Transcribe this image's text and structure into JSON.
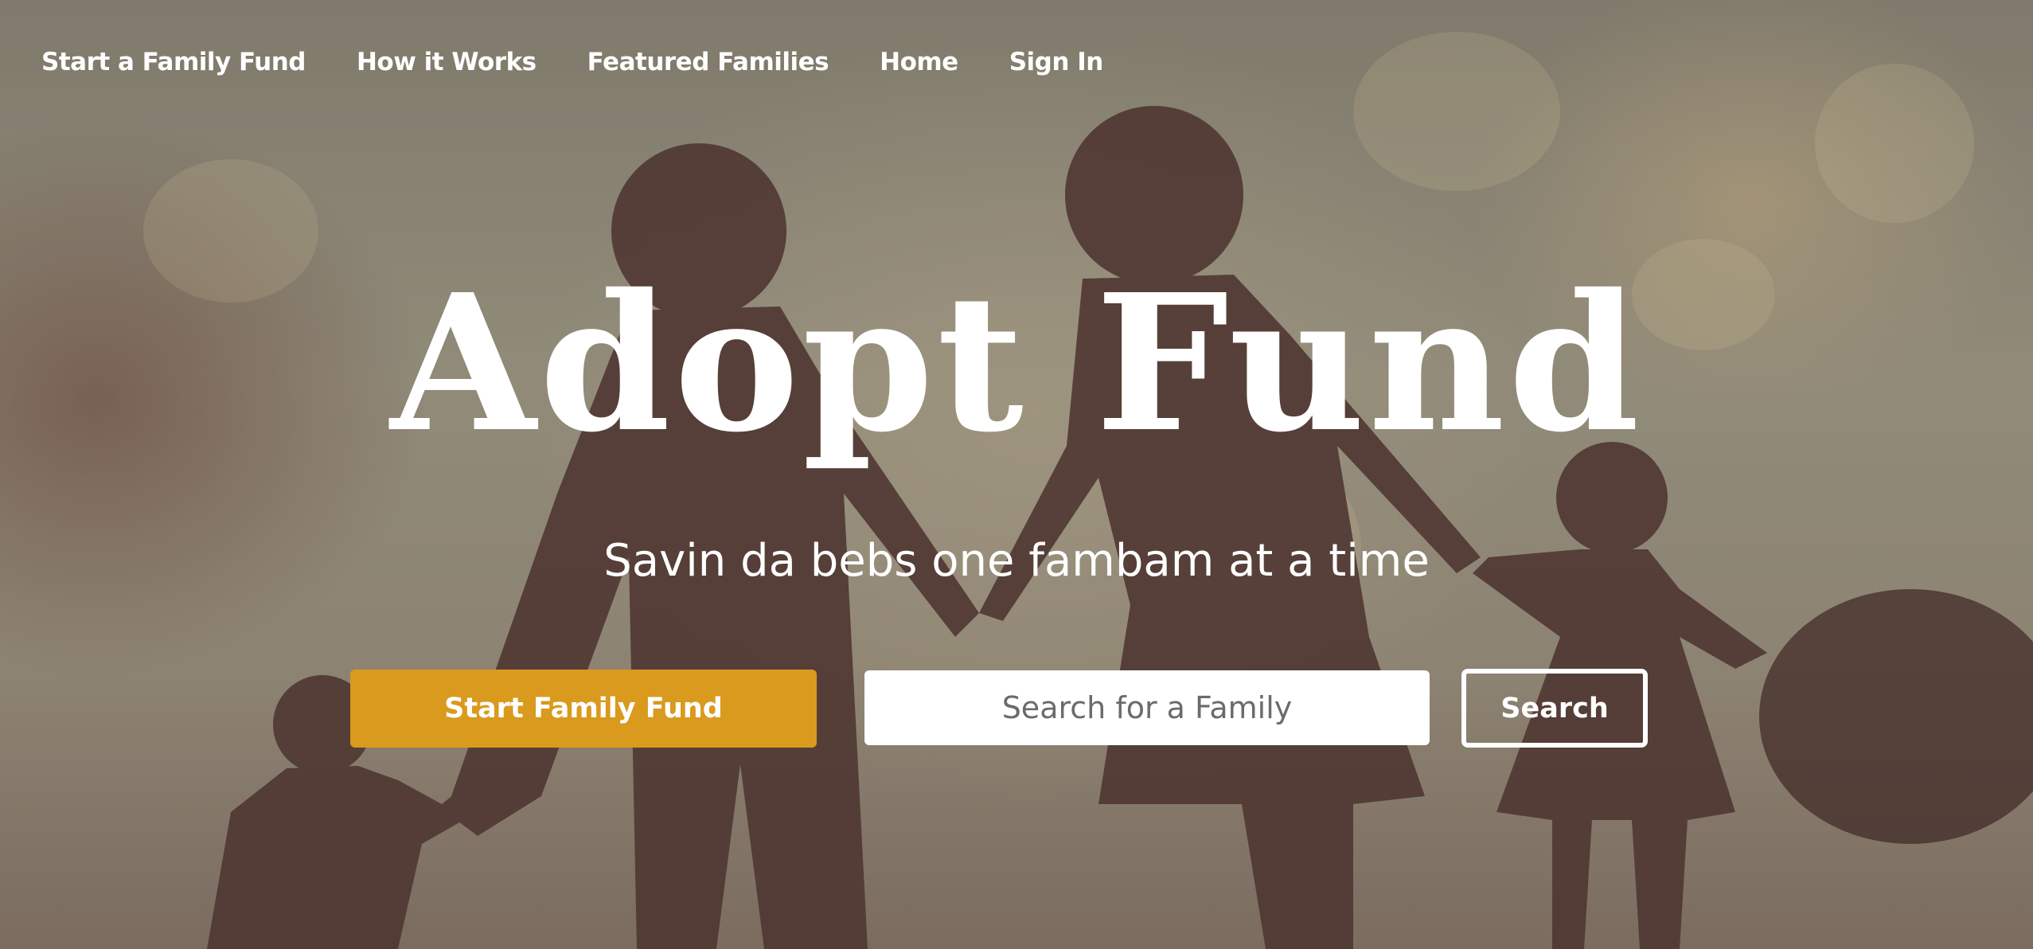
{
  "nav": {
    "items": [
      {
        "label": "Start a Family Fund"
      },
      {
        "label": "How it Works"
      },
      {
        "label": "Featured Families"
      },
      {
        "label": "Home"
      },
      {
        "label": "Sign In"
      }
    ]
  },
  "hero": {
    "title": "Adopt Fund",
    "subtitle": "Savin da bebs one fambam at a time"
  },
  "actions": {
    "start_label": "Start Family Fund",
    "search_placeholder": "Search for a Family",
    "search_label": "Search"
  },
  "colors": {
    "accent": "#d99a1e",
    "text": "#ffffff",
    "silhouette": "#5a4039"
  }
}
